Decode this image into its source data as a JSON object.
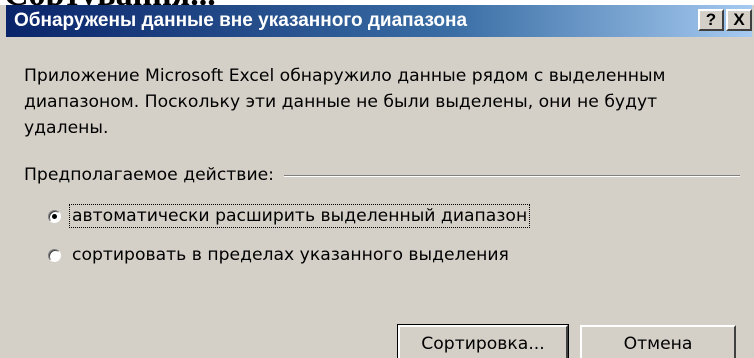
{
  "background_doc": {
    "text": "Сортування..."
  },
  "dialog": {
    "title": "Обнаружены данные вне указанного диапазона",
    "help_button_label": "?",
    "close_button_label": "X",
    "message": "Приложение Microsoft Excel обнаружило данные рядом с выделенным диапазоном. Поскольку эти данные не были выделены, они не будут удалены.",
    "group_label": "Предполагаемое действие:",
    "options": [
      {
        "label": "автоматически расширить выделенный диапазон",
        "selected": true
      },
      {
        "label": "сортировать в пределах указанного выделения",
        "selected": false
      }
    ],
    "buttons": {
      "sort_label": "Сортировка...",
      "cancel_label": "Отмена"
    }
  },
  "colors": {
    "dialog_bg": "#d4d0c8",
    "titlebar_start": "#0a246a",
    "titlebar_end": "#a6caf0",
    "title_text": "#ffffff"
  }
}
